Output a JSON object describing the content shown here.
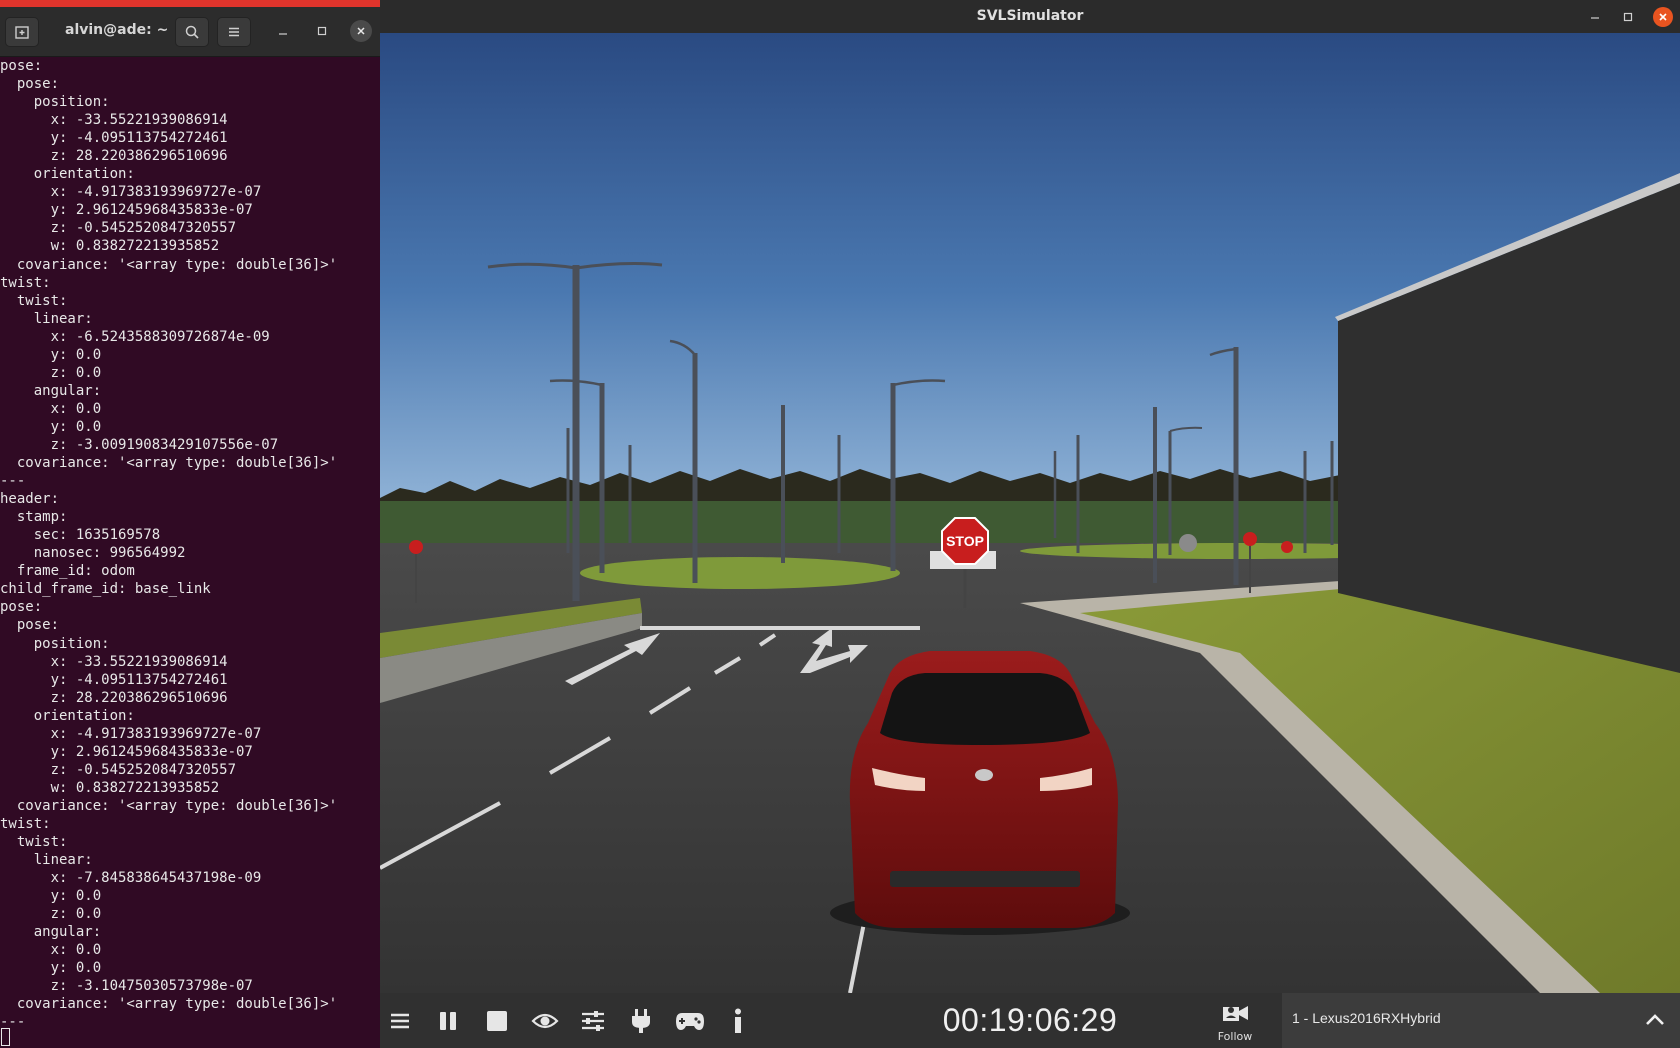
{
  "terminal": {
    "title": "alvin@ade: ~",
    "lines": [
      "pose:",
      "  pose:",
      "    position:",
      "      x: -33.55221939086914",
      "      y: -4.095113754272461",
      "      z: 28.220386296510696",
      "    orientation:",
      "      x: -4.917383193969727e-07",
      "      y: 2.961245968435833e-07",
      "      z: -0.5452520847320557",
      "      w: 0.838272213935852",
      "  covariance: '<array type: double[36]>'",
      "twist:",
      "  twist:",
      "    linear:",
      "      x: -6.5243588309726874e-09",
      "      y: 0.0",
      "      z: 0.0",
      "    angular:",
      "      x: 0.0",
      "      y: 0.0",
      "      z: -3.00919083429107556e-07",
      "  covariance: '<array type: double[36]>'",
      "---",
      "header:",
      "  stamp:",
      "    sec: 1635169578",
      "    nanosec: 996564992",
      "  frame_id: odom",
      "child_frame_id: base_link",
      "pose:",
      "  pose:",
      "    position:",
      "      x: -33.55221939086914",
      "      y: -4.095113754272461",
      "      z: 28.220386296510696",
      "    orientation:",
      "      x: -4.917383193969727e-07",
      "      y: 2.961245968435833e-07",
      "      z: -0.5452520847320557",
      "      w: 0.838272213935852",
      "  covariance: '<array type: double[36]>'",
      "twist:",
      "  twist:",
      "    linear:",
      "      x: -7.845838645437198e-09",
      "      y: 0.0",
      "      z: 0.0",
      "    angular:",
      "      x: 0.0",
      "      y: 0.0",
      "      z: -3.10475030573798e-07",
      "  covariance: '<array type: double[36]>'",
      "---"
    ]
  },
  "simulator": {
    "title": "SVLSimulator",
    "timer": "00:19:06:29",
    "follow_label": "Follow",
    "vehicle_label": "1 - Lexus2016RXHybrid",
    "scene": {
      "stop_sign_text": "STOP"
    }
  },
  "colors": {
    "terminal_bg": "#300a24",
    "accent_orange": "#e95420",
    "toolbar_bg": "#303030"
  }
}
